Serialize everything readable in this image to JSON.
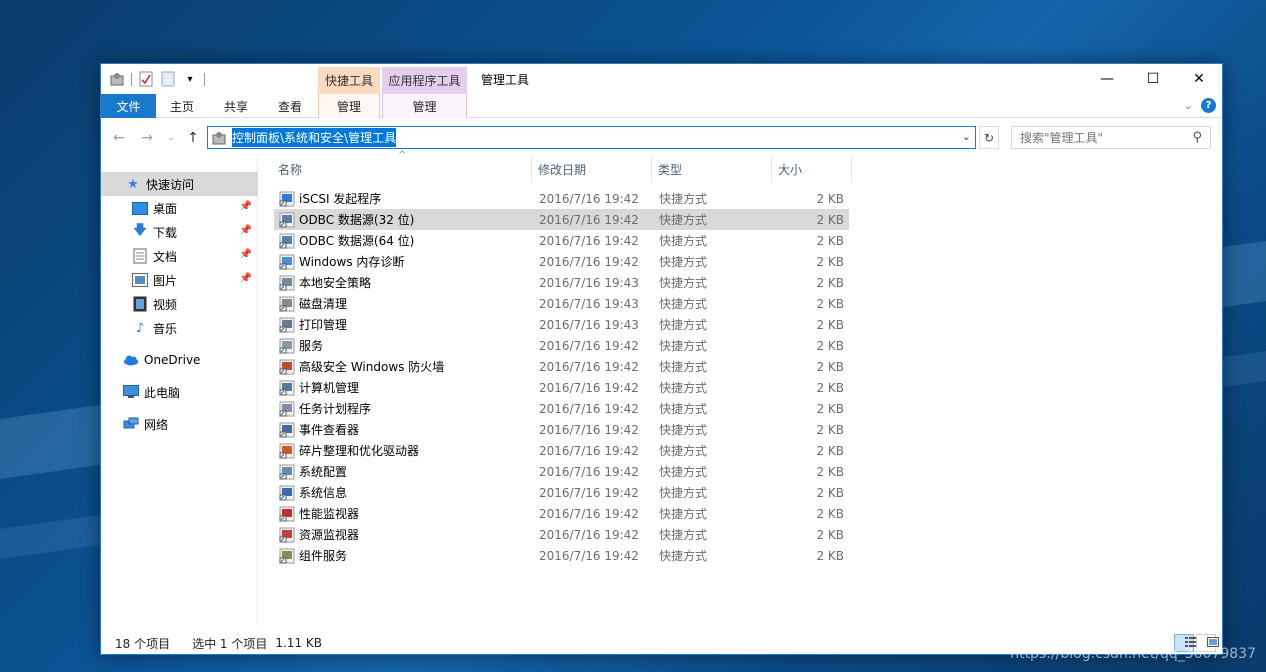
{
  "window": {
    "title": "管理工具",
    "context_tab_shortcut": "快捷工具",
    "context_tab_app": "应用程序工具",
    "controls": {
      "minimize": "—",
      "maximize": "☐",
      "close": "✕"
    }
  },
  "ribbon": {
    "tabs": [
      {
        "label": "文件"
      },
      {
        "label": "主页"
      },
      {
        "label": "共享"
      },
      {
        "label": "查看"
      },
      {
        "label": "管理"
      },
      {
        "label": "管理"
      }
    ]
  },
  "address_bar": {
    "path": "控制面板\\系统和安全\\管理工具"
  },
  "search": {
    "placeholder": "搜索\"管理工具\""
  },
  "nav_pane": {
    "items": [
      {
        "label": "快速访问",
        "icon": "star-icon",
        "pinned": false
      },
      {
        "label": "桌面",
        "icon": "desktop-icon",
        "pinned": true
      },
      {
        "label": "下载",
        "icon": "download-icon",
        "pinned": true
      },
      {
        "label": "文档",
        "icon": "document-icon",
        "pinned": true
      },
      {
        "label": "图片",
        "icon": "pictures-icon",
        "pinned": true
      },
      {
        "label": "视频",
        "icon": "video-icon",
        "pinned": false
      },
      {
        "label": "音乐",
        "icon": "music-icon",
        "pinned": false
      },
      {
        "label": "OneDrive",
        "icon": "cloud-icon",
        "pinned": false
      },
      {
        "label": "此电脑",
        "icon": "computer-icon",
        "pinned": false
      },
      {
        "label": "网络",
        "icon": "network-icon",
        "pinned": false
      }
    ]
  },
  "file_list": {
    "columns": {
      "name": "名称",
      "date": "修改日期",
      "type": "类型",
      "size": "大小"
    },
    "rows": [
      {
        "name": "iSCSI 发起程序",
        "date": "2016/7/16 19:42",
        "type": "快捷方式",
        "size": "2 KB"
      },
      {
        "name": "ODBC 数据源(32 位)",
        "date": "2016/7/16 19:42",
        "type": "快捷方式",
        "size": "2 KB"
      },
      {
        "name": "ODBC 数据源(64 位)",
        "date": "2016/7/16 19:42",
        "type": "快捷方式",
        "size": "2 KB"
      },
      {
        "name": "Windows 内存诊断",
        "date": "2016/7/16 19:42",
        "type": "快捷方式",
        "size": "2 KB"
      },
      {
        "name": "本地安全策略",
        "date": "2016/7/16 19:43",
        "type": "快捷方式",
        "size": "2 KB"
      },
      {
        "name": "磁盘清理",
        "date": "2016/7/16 19:43",
        "type": "快捷方式",
        "size": "2 KB"
      },
      {
        "name": "打印管理",
        "date": "2016/7/16 19:43",
        "type": "快捷方式",
        "size": "2 KB"
      },
      {
        "name": "服务",
        "date": "2016/7/16 19:42",
        "type": "快捷方式",
        "size": "2 KB"
      },
      {
        "name": "高级安全 Windows 防火墙",
        "date": "2016/7/16 19:42",
        "type": "快捷方式",
        "size": "2 KB"
      },
      {
        "name": "计算机管理",
        "date": "2016/7/16 19:42",
        "type": "快捷方式",
        "size": "2 KB"
      },
      {
        "name": "任务计划程序",
        "date": "2016/7/16 19:42",
        "type": "快捷方式",
        "size": "2 KB"
      },
      {
        "name": "事件查看器",
        "date": "2016/7/16 19:42",
        "type": "快捷方式",
        "size": "2 KB"
      },
      {
        "name": "碎片整理和优化驱动器",
        "date": "2016/7/16 19:42",
        "type": "快捷方式",
        "size": "2 KB"
      },
      {
        "name": "系统配置",
        "date": "2016/7/16 19:42",
        "type": "快捷方式",
        "size": "2 KB"
      },
      {
        "name": "系统信息",
        "date": "2016/7/16 19:42",
        "type": "快捷方式",
        "size": "2 KB"
      },
      {
        "name": "性能监视器",
        "date": "2016/7/16 19:42",
        "type": "快捷方式",
        "size": "2 KB"
      },
      {
        "name": "资源监视器",
        "date": "2016/7/16 19:42",
        "type": "快捷方式",
        "size": "2 KB"
      },
      {
        "name": "组件服务",
        "date": "2016/7/16 19:42",
        "type": "快捷方式",
        "size": "2 KB"
      }
    ],
    "selected_index": 1
  },
  "status_bar": {
    "item_count": "18 个项目",
    "selection": "选中 1 个项目",
    "size": "1.11 KB"
  },
  "watermark": "https://blog.csdn.net/qq_36079837",
  "colors": {
    "accent": "#1979ca",
    "selection": "#d9d9d9",
    "shortcut_tab": "#fbd9c1",
    "app_tab": "#e5cdee"
  }
}
